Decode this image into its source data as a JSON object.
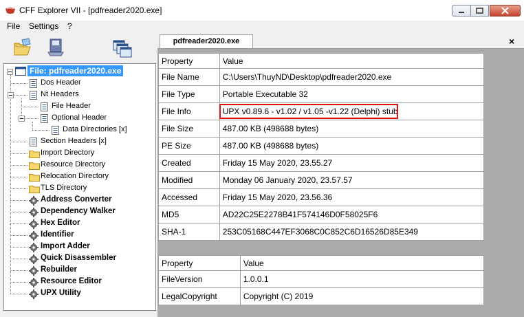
{
  "window": {
    "title": "CFF Explorer VII - [pdfreader2020.exe]"
  },
  "menu": [
    "File",
    "Settings",
    "?"
  ],
  "toolbar": {
    "icons": [
      "open-folder-icon",
      "save-disk-icon",
      "windows-icon"
    ]
  },
  "tree": {
    "root": "File: pdfreader2020.exe",
    "items": [
      {
        "label": "Dos Header",
        "icon": "page-icon",
        "bold": false
      },
      {
        "label": "Nt Headers",
        "icon": "page-icon",
        "bold": false
      },
      {
        "label": "File Header",
        "icon": "page-icon",
        "bold": false
      },
      {
        "label": "Optional Header",
        "icon": "page-icon",
        "bold": false
      },
      {
        "label": "Data Directories [x]",
        "icon": "page-icon",
        "bold": false
      },
      {
        "label": "Section Headers [x]",
        "icon": "page-icon",
        "bold": false
      },
      {
        "label": "Import Directory",
        "icon": "folder-icon",
        "bold": false
      },
      {
        "label": "Resource Directory",
        "icon": "folder-icon",
        "bold": false
      },
      {
        "label": "Relocation Directory",
        "icon": "folder-icon",
        "bold": false
      },
      {
        "label": "TLS Directory",
        "icon": "folder-icon",
        "bold": false
      },
      {
        "label": "Address Converter",
        "icon": "tool-icon",
        "bold": true
      },
      {
        "label": "Dependency Walker",
        "icon": "tool-icon",
        "bold": true
      },
      {
        "label": "Hex Editor",
        "icon": "tool-icon",
        "bold": true
      },
      {
        "label": "Identifier",
        "icon": "tool-icon",
        "bold": true
      },
      {
        "label": "Import Adder",
        "icon": "tool-icon",
        "bold": true
      },
      {
        "label": "Quick Disassembler",
        "icon": "tool-icon",
        "bold": true
      },
      {
        "label": "Rebuilder",
        "icon": "tool-icon",
        "bold": true
      },
      {
        "label": "Resource Editor",
        "icon": "tool-icon",
        "bold": true
      },
      {
        "label": "UPX Utility",
        "icon": "tool-icon",
        "bold": true
      }
    ]
  },
  "tab": {
    "label": "pdfreader2020.exe",
    "close": "×"
  },
  "main_table": {
    "headers": [
      "Property",
      "Value"
    ],
    "rows": [
      [
        "File Name",
        "C:\\Users\\ThuyND\\Desktop\\pdfreader2020.exe"
      ],
      [
        "File Type",
        "Portable Executable 32"
      ],
      [
        "File Info",
        "UPX v0.89.6 - v1.02 / v1.05 -v1.22 (Delphi) stub"
      ],
      [
        "File Size",
        "487.00 KB (498688 bytes)"
      ],
      [
        "PE Size",
        "487.00 KB (498688 bytes)"
      ],
      [
        "Created",
        "Friday 15 May 2020, 23.55.27"
      ],
      [
        "Modified",
        "Monday 06 January 2020, 23.57.57"
      ],
      [
        "Accessed",
        "Friday 15 May 2020, 23.56.36"
      ],
      [
        "MD5",
        "AD22C25E2278B41F574146D0F58025F6"
      ],
      [
        "SHA-1",
        "253C05168C447EF3068C0C852C6D16526D85E349"
      ]
    ]
  },
  "version_table": {
    "headers": [
      "Property",
      "Value"
    ],
    "rows": [
      [
        "FileVersion",
        "1.0.0.1"
      ],
      [
        "LegalCopyright",
        "Copyright (C) 2019"
      ]
    ]
  },
  "colors": {
    "selection": "#3399ff",
    "highlight_box": "#e01010",
    "panel_bg": "#ababab"
  }
}
